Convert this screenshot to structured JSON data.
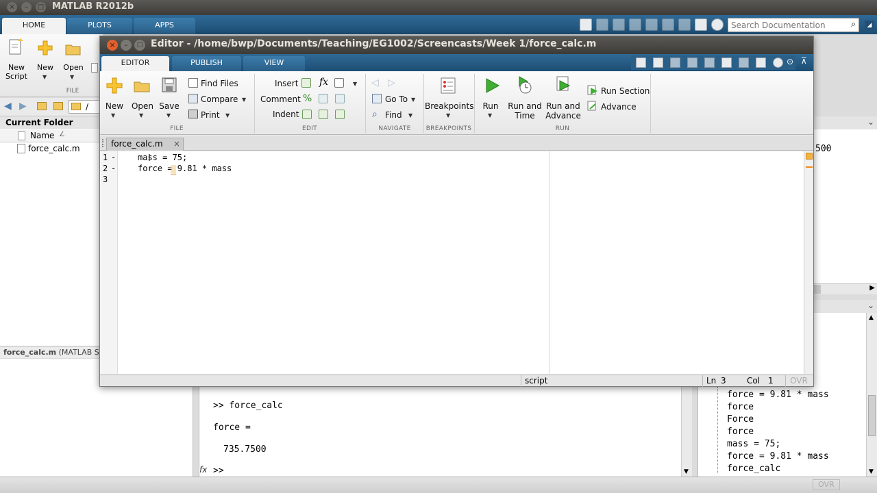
{
  "app": {
    "title": "MATLAB R2012b"
  },
  "main_tabs": [
    "HOME",
    "PLOTS",
    "APPS"
  ],
  "main_ribbon": {
    "new_script": "New\nScript",
    "new": "New",
    "open": "Open",
    "file_group": "FILE"
  },
  "search": {
    "placeholder": "Search Documentation"
  },
  "address": {
    "path": "/"
  },
  "current_folder": {
    "title": "Current Folder",
    "column_name": "Name",
    "sort_glyph": "∠",
    "files": [
      "force_calc.m"
    ],
    "details_file": "force_calc.m",
    "details_type": "(MATLAB Sc"
  },
  "workspace": {
    "value_fragment": "500"
  },
  "command_window": {
    "lines": [
      ">> force_calc",
      "force =",
      "735.7500"
    ],
    "prompt": ">>",
    "fx_label": "fx"
  },
  "command_history": {
    "items": [
      "force = 9.81 * mass",
      "force",
      "Force",
      "force",
      "mass = 75;",
      "force = 9.81 * mass",
      "force_calc"
    ]
  },
  "status": {
    "ovr": "OVR"
  },
  "editor": {
    "title": "Editor - /home/bwp/Documents/Teaching/EG1002/Screencasts/Week 1/force_calc.m",
    "tabs": [
      "EDITOR",
      "PUBLISH",
      "VIEW"
    ],
    "file_group": {
      "new": "New",
      "open": "Open",
      "save": "Save",
      "find_files": "Find Files",
      "compare": "Compare",
      "print": "Print",
      "label": "FILE"
    },
    "edit_group": {
      "insert": "Insert",
      "comment": "Comment",
      "indent": "Indent",
      "fx": "fx",
      "comment_symbol": "%",
      "label": "EDIT"
    },
    "navigate_group": {
      "go_to": "Go To",
      "find": "Find",
      "label": "NAVIGATE"
    },
    "breakpoints_group": {
      "breakpoints": "Breakpoints",
      "label": "BREAKPOINTS"
    },
    "run_group": {
      "run": "Run",
      "run_and_time": "Run and\nTime",
      "run_and_advance": "Run and\nAdvance",
      "run_section": "Run Section",
      "advance": "Advance",
      "label": "RUN"
    },
    "file_tab": "force_calc.m",
    "file_tab_close": "×",
    "code": [
      {
        "num": "1",
        "mark": "-",
        "text": "mass = 75;"
      },
      {
        "num": "2",
        "mark": "-",
        "text": "force = 9.81 * mass"
      },
      {
        "num": "3",
        "mark": "",
        "text": ""
      }
    ],
    "status": {
      "mode": "script",
      "ln_label": "Ln",
      "ln": "3",
      "col_label": "Col",
      "col": "1",
      "ovr": "OVR"
    }
  },
  "colors": {
    "ribbon_blue": "#1d4d73",
    "titlebar_dark": "#3c3b37",
    "close_button": "#e0602f",
    "run_green": "#2f9a2a"
  }
}
